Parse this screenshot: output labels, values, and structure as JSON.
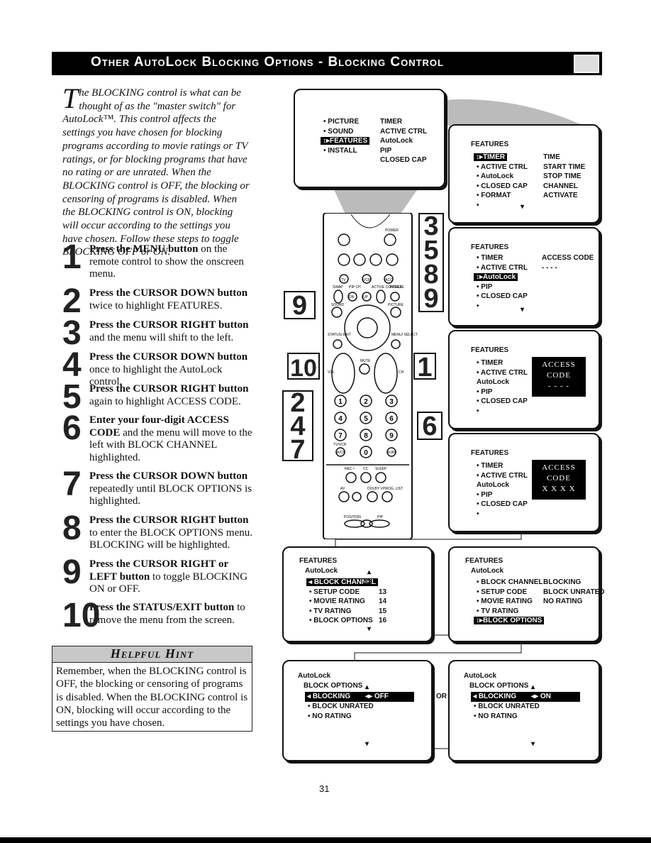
{
  "title": "Other AutoLock Blocking Options - Blocking Control",
  "intro": {
    "drop_cap": "T",
    "text": "he BLOCKING control is what can be thought of as the \"master switch\" for AutoLock™. This control affects the settings you have chosen for blocking programs according to movie ratings or TV ratings, or for blocking programs that have no rating or are unrated. When the BLOCKING control is OFF, the blocking or censoring of programs is disabled. When the BLOCKING control is ON, blocking will occur according to the settings you have chosen. Follow these steps to toggle BLOCKING OFF or ON."
  },
  "steps": [
    {
      "num": "1",
      "bold": "Press the MENU button",
      "rest": " on the remote control to show the onscreen menu."
    },
    {
      "num": "2",
      "bold": "Press the CURSOR DOWN button",
      "rest": " twice to highlight FEATURES."
    },
    {
      "num": "3",
      "bold": "Press the CURSOR RIGHT button",
      "rest": " and the menu will shift to the left."
    },
    {
      "num": "4",
      "bold": "Press the CURSOR DOWN button",
      "rest": " once to highlight the AutoLock control."
    },
    {
      "num": "5",
      "bold": "Press the CURSOR RIGHT button",
      "rest": " again to highlight ACCESS CODE."
    },
    {
      "num": "6",
      "bold": "Enter your four-digit ACCESS CODE",
      "rest": " and the menu will move to the left with BLOCK CHANNEL highlighted."
    },
    {
      "num": "7",
      "bold": "Press the CURSOR DOWN button",
      "rest": " repeatedly until BLOCK OPTIONS is highlighted."
    },
    {
      "num": "8",
      "bold": "Press the CURSOR RIGHT button",
      "rest": " to enter the BLOCK OPTIONS menu. BLOCKING will be highlighted."
    },
    {
      "num": "9",
      "bold": "Press the CURSOR RIGHT or LEFT button",
      "rest": " to toggle BLOCKING ON or OFF."
    },
    {
      "num": "10",
      "bold": "Press the STATUS/EXIT button",
      "rest": " to remove the menu from the screen."
    }
  ],
  "hint": {
    "title": "Helpful Hint",
    "text": "Remember, when the BLOCKING control is OFF, the blocking or censoring of programs is disabled. When the BLOCKING control is ON, blocking will occur according to the settings you have chosen."
  },
  "screens": {
    "main": {
      "left": [
        "• PICTURE",
        "• SOUND",
        "FEATURES",
        "• INSTALL"
      ],
      "right": [
        "TIMER",
        "ACTIVE CTRL",
        "AutoLock",
        "PIP",
        "CLOSED CAP"
      ]
    },
    "features1": {
      "head": "FEATURES",
      "left": [
        "TIMER",
        "• ACTIVE CTRL",
        "• AutoLock",
        "• CLOSED CAP",
        "• FORMAT",
        "•"
      ],
      "right": [
        "TIME",
        "START TIME",
        "STOP TIME",
        "CHANNEL",
        "ACTIVATE"
      ]
    },
    "features2": {
      "head": "FEATURES",
      "left": [
        "• TIMER",
        "• ACTIVE CTRL",
        "AutoLock",
        "• PIP",
        "• CLOSED CAP",
        "•"
      ],
      "right": [
        "ACCESS CODE",
        "- - - -"
      ]
    },
    "features3": {
      "head": "FEATURES",
      "left": [
        "• TIMER",
        "• ACTIVE CTRL",
        "AutoLock",
        "• PIP",
        "• CLOSED CAP",
        "•"
      ],
      "code_label": "ACCESS CODE",
      "code": "- - - -"
    },
    "features4": {
      "head": "FEATURES",
      "left": [
        "• TIMER",
        "• ACTIVE CTRL",
        "AutoLock",
        "• PIP",
        "• CLOSED CAP",
        "•"
      ],
      "code_label": "ACCESS CODE",
      "code": "X X X X"
    },
    "autolock1": {
      "head": "FEATURES",
      "sub": "AutoLock",
      "left": [
        "BLOCK CHANNEL",
        "• SETUP CODE",
        "• MOVIE RATING",
        "• TV RATING",
        "• BLOCK OPTIONS"
      ],
      "right": [
        "12",
        "13",
        "14",
        "15",
        "16"
      ]
    },
    "autolock2": {
      "head": "FEATURES",
      "sub": "AutoLock",
      "left": [
        "• BLOCK CHANNEL",
        "• SETUP CODE",
        "• MOVIE RATING",
        "• TV RATING",
        "BLOCK OPTIONS"
      ],
      "right": [
        "BLOCKING",
        "BLOCK UNRATED",
        "NO RATING"
      ]
    },
    "options_off": {
      "head": "AutoLock",
      "sub": "BLOCK OPTIONS",
      "items": [
        "BLOCKING",
        "• BLOCK UNRATED",
        "• NO RATING"
      ],
      "value": "OFF"
    },
    "options_on": {
      "head": "AutoLock",
      "sub": "BLOCK OPTIONS",
      "items": [
        "BLOCKING",
        "• BLOCK UNRATED",
        "• NO RATING"
      ],
      "value": "ON"
    },
    "or_label": "OR"
  },
  "remote": {
    "power": "POWER",
    "swap": "SWAP",
    "pip_ch": "PIP CH",
    "active_control": "ACTIVE CONTROL",
    "freeze": "FREEZE",
    "sound": "SOUND",
    "picture": "PICTURE",
    "status_exit": "STATUS/ EXIT",
    "menu_select": "MENU/ SELECT",
    "mute": "MUTE",
    "vol": "VOL",
    "ch": "CH",
    "tv": "TV",
    "vcr": "VCR",
    "acc": "ACC",
    "dn": "DN",
    "up": "UP",
    "tvvcr": "TV/VCR",
    "avch": "A/CH",
    "surf": "SURF",
    "rec": "REC •",
    "cc": "CC",
    "sleep": "SLEEP",
    "av": "AV",
    "dolby": "DOLBY V",
    "prog": "PROG. LIST",
    "position": "POSITION",
    "pip": "PIP",
    "digits": [
      "1",
      "2",
      "3",
      "4",
      "5",
      "6",
      "7",
      "8",
      "9",
      "0"
    ]
  },
  "callouts": {
    "left": [
      "9",
      "10",
      "2",
      "4",
      "7"
    ],
    "right": [
      "3",
      "5",
      "8",
      "9",
      "1",
      "6"
    ]
  },
  "page_number": "31"
}
